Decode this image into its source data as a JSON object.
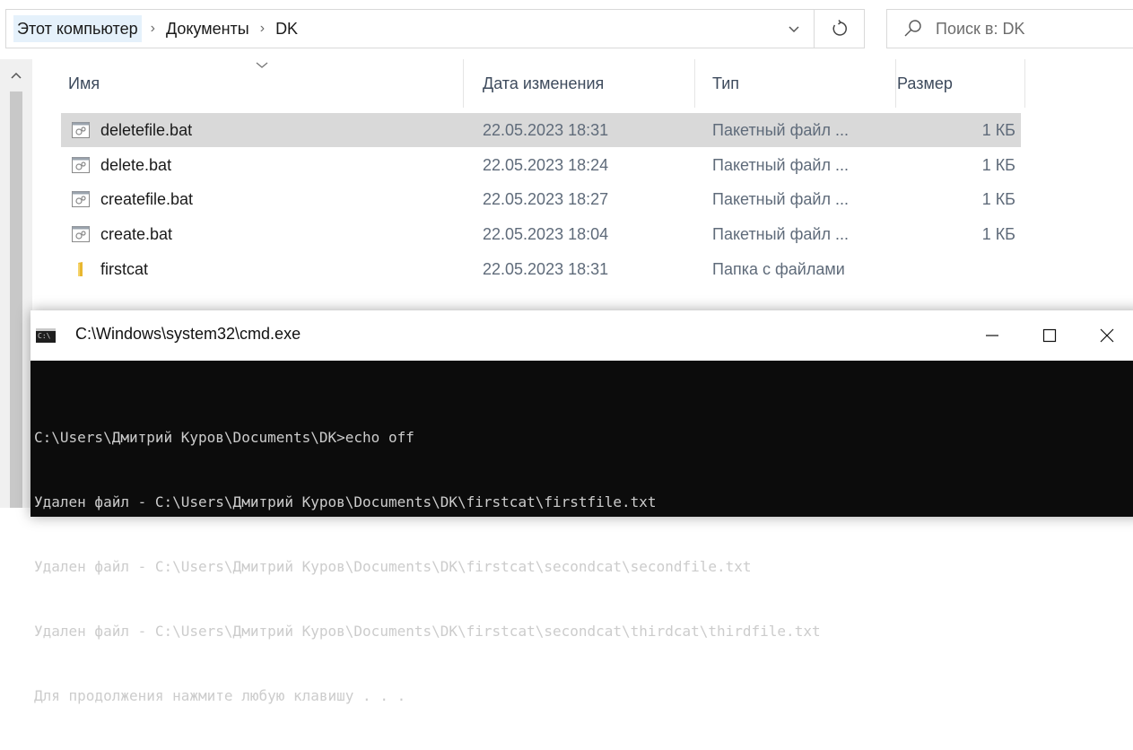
{
  "breadcrumb": {
    "items": [
      "Этот компьютер",
      "Документы",
      "DK"
    ]
  },
  "search": {
    "placeholder": "Поиск в: DK"
  },
  "columns": [
    "Имя",
    "Дата изменения",
    "Тип",
    "Размер"
  ],
  "files": [
    {
      "name": "deletefile.bat",
      "date": "22.05.2023 18:31",
      "type": "Пакетный файл ...",
      "size": "1 КБ",
      "icon": "batch-file-icon",
      "selected": true
    },
    {
      "name": "delete.bat",
      "date": "22.05.2023 18:24",
      "type": "Пакетный файл ...",
      "size": "1 КБ",
      "icon": "batch-file-icon",
      "selected": false
    },
    {
      "name": "createfile.bat",
      "date": "22.05.2023 18:27",
      "type": "Пакетный файл ...",
      "size": "1 КБ",
      "icon": "batch-file-icon",
      "selected": false
    },
    {
      "name": "create.bat",
      "date": "22.05.2023 18:04",
      "type": "Пакетный файл ...",
      "size": "1 КБ",
      "icon": "batch-file-icon",
      "selected": false
    },
    {
      "name": "firstcat",
      "date": "22.05.2023 18:31",
      "type": "Папка с файлами",
      "size": "",
      "icon": "folder-icon",
      "selected": false
    }
  ],
  "cmd": {
    "title": "C:\\Windows\\system32\\cmd.exe",
    "icon_label": "C:\\",
    "lines": [
      "C:\\Users\\Дмитрий Куров\\Documents\\DK>echo off",
      "Удален файл - C:\\Users\\Дмитрий Куров\\Documents\\DK\\firstcat\\firstfile.txt",
      "Удален файл - C:\\Users\\Дмитрий Куров\\Documents\\DK\\firstcat\\secondcat\\secondfile.txt",
      "Удален файл - C:\\Users\\Дмитрий Куров\\Documents\\DK\\firstcat\\secondcat\\thirdcat\\thirdfile.txt",
      "Для продолжения нажмите любую клавишу . . ."
    ]
  },
  "colors": {
    "selection": "#d9d9d9",
    "crumb_highlight": "#e5f1fb",
    "console_bg": "#0c0c0c",
    "console_text": "#cccccc",
    "folder": "#e8b730"
  }
}
